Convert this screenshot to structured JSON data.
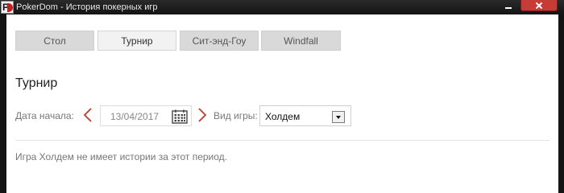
{
  "window": {
    "title": "PokerDom - История покерных игр",
    "icon": "pokerdom-logo-icon",
    "icon_text": "P"
  },
  "tabs": [
    {
      "label": "Стол",
      "active": false
    },
    {
      "label": "Турнир",
      "active": true
    },
    {
      "label": "Сит-энд-Гоу",
      "active": false
    },
    {
      "label": "Windfall",
      "active": false
    }
  ],
  "main": {
    "heading": "Турнир",
    "date_label": "Дата начала:",
    "date_value": "13/04/2017",
    "game_type_label": "Вид игры:",
    "game_type_value": "Холдем",
    "message": "Игра Холдем не имеет истории за этот период."
  },
  "colors": {
    "accent": "#c0392b",
    "close_button": "#c43c35",
    "tab_bg": "#d9d9d9",
    "tab_active_bg": "#f2f2f2"
  },
  "icons": {
    "prev": "chevron-left-icon",
    "next": "chevron-right-icon",
    "calendar": "calendar-icon",
    "dropdown": "dropdown-arrow-icon",
    "minimize": "minimize-icon",
    "close": "close-icon"
  }
}
